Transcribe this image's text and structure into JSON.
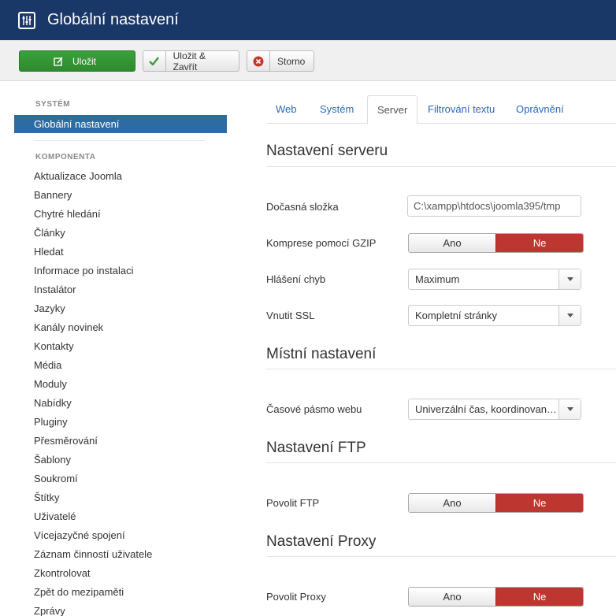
{
  "header": {
    "title": "Globální nastavení"
  },
  "toolbar": {
    "save": "Uložit",
    "save_close": "Uložit & Zavřít",
    "cancel": "Storno"
  },
  "sidebar": {
    "system_heading": "SYSTÉM",
    "active_item": "Globální nastavení",
    "component_heading": "KOMPONENTA",
    "items": [
      "Aktualizace Joomla",
      "Bannery",
      "Chytré hledání",
      "Články",
      "Hledat",
      "Informace po instalaci",
      "Instalátor",
      "Jazyky",
      "Kanály novinek",
      "Kontakty",
      "Média",
      "Moduly",
      "Nabídky",
      "Pluginy",
      "Přesměrování",
      "Šablony",
      "Soukromí",
      "Štítky",
      "Uživatelé",
      "Vícejazyčné spojení",
      "Záznam činností uživatele",
      "Zkontrolovat",
      "Zpět do mezipaměti",
      "Zprávy"
    ]
  },
  "tabs": [
    "Web",
    "Systém",
    "Server",
    "Filtrování textu",
    "Oprávnění"
  ],
  "server": {
    "title": "Nastavení serveru",
    "temp_label": "Dočasná složka",
    "temp_value": "C:\\xampp\\htdocs\\joomla395/tmp",
    "gzip_label": "Komprese pomocí GZIP",
    "error_label": "Hlášení chyb",
    "error_value": "Maximum",
    "ssl_label": "Vnutit SSL",
    "ssl_value": "Kompletní stránky"
  },
  "locale": {
    "title": "Místní nastavení",
    "tz_label": "Časové pásmo webu",
    "tz_value": "Univerzální čas, koordinovaný (UTC)"
  },
  "ftp": {
    "title": "Nastavení FTP",
    "enable_label": "Povolit FTP"
  },
  "proxy": {
    "title": "Nastavení Proxy",
    "enable_label": "Povolit Proxy"
  },
  "toggle": {
    "yes": "Ano",
    "no": "Ne"
  },
  "colors": {
    "header": "#1a3867",
    "save": "#3aa13a",
    "active_no": "#bd362f",
    "sidebar_active": "#2d6ca2"
  }
}
